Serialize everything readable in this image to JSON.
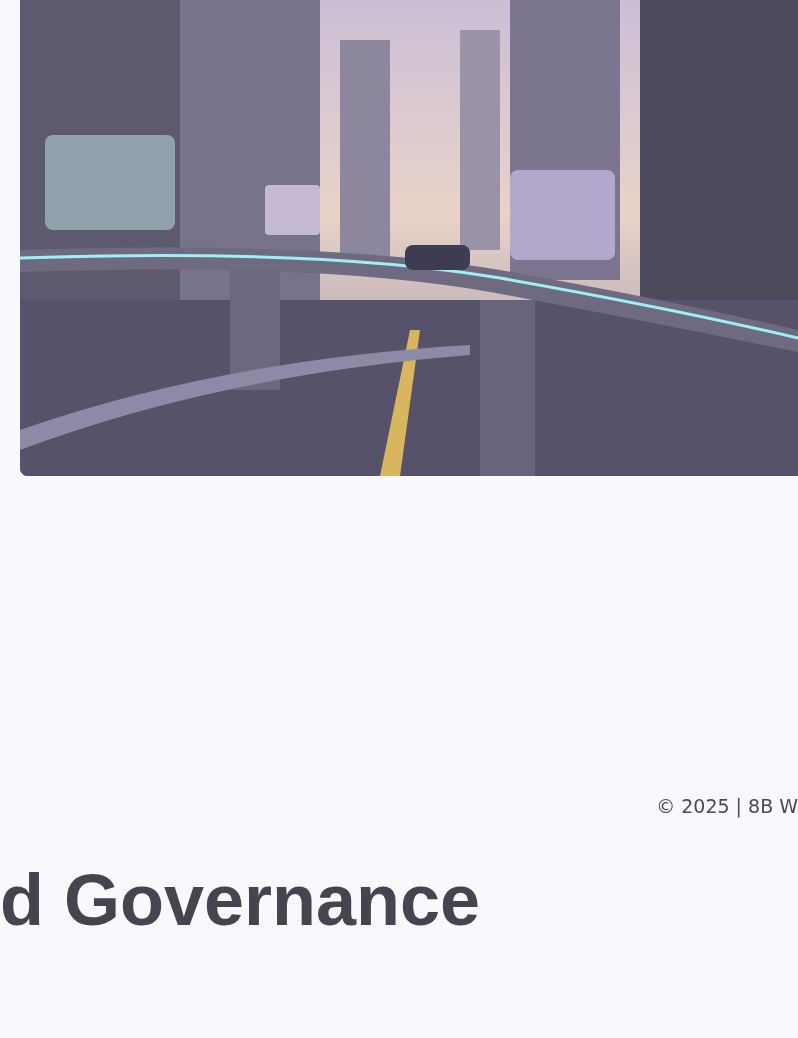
{
  "footer": {
    "copyright": "© 2025 | 8B W"
  },
  "heading": "d Governance"
}
